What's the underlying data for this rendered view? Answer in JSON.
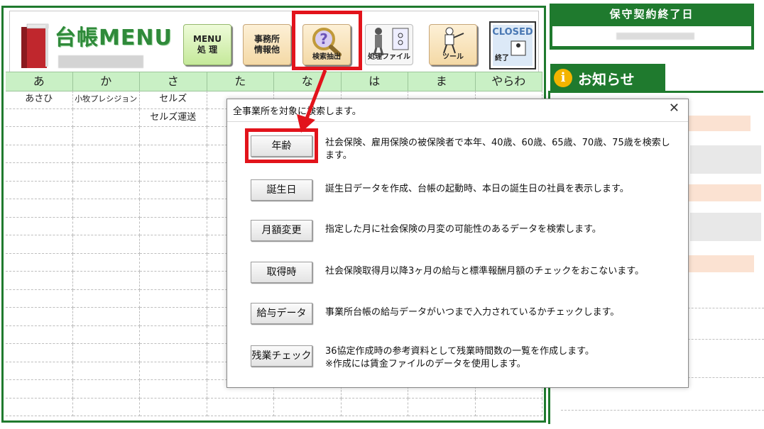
{
  "app": {
    "title": "台帳MENU"
  },
  "toolbar": {
    "menu_btn": "MENU\n処 理",
    "office_btn": "事務所\n情報他",
    "search_btn": "検索抽出",
    "file_btn": "処理ファイル",
    "tool_btn": "ツール",
    "closed_top": "CLOSED",
    "closed_bottom": "終了"
  },
  "kana": {
    "headers": [
      "あ",
      "か",
      "さ",
      "た",
      "な",
      "は",
      "ま",
      "やらわ"
    ],
    "rows": [
      [
        "あさひ",
        "小牧プレシジョン",
        "セルズ",
        "",
        "",
        "",
        "",
        ""
      ],
      [
        "",
        "",
        "セルズ運送",
        "",
        "",
        "",
        "",
        ""
      ]
    ]
  },
  "right": {
    "contract_title": "保守契約終了日",
    "notice_title": "お知らせ",
    "info_glyph": "i"
  },
  "dialog": {
    "title": "全事業所を対象に検索します。",
    "close": "✕",
    "options": [
      {
        "label": "年齢",
        "desc": "社会保険、雇用保険の被保険者で本年、40歳、60歳、65歳、70歳、75歳を検索します。"
      },
      {
        "label": "誕生日",
        "desc": "誕生日データを作成、台帳の起動時、本日の誕生日の社員を表示します。"
      },
      {
        "label": "月額変更",
        "desc": "指定した月に社会保険の月変の可能性のあるデータを検索します。"
      },
      {
        "label": "取得時",
        "desc": "社会保険取得月以降3ヶ月の給与と標準報酬月額のチェックをおこないます。"
      },
      {
        "label": "給与データ",
        "desc": "事業所台帳の給与データがいつまで入力されているかチェックします。"
      },
      {
        "label": "残業チェック",
        "desc": "36協定作成時の参考資料として残業時間数の一覧を作成します。\n※作成には賃金ファイルのデータを使用します。"
      }
    ]
  },
  "colors": {
    "frame_green": "#1f7a2e",
    "highlight_red": "#e2131b",
    "header_mint": "#c9f0c5"
  }
}
